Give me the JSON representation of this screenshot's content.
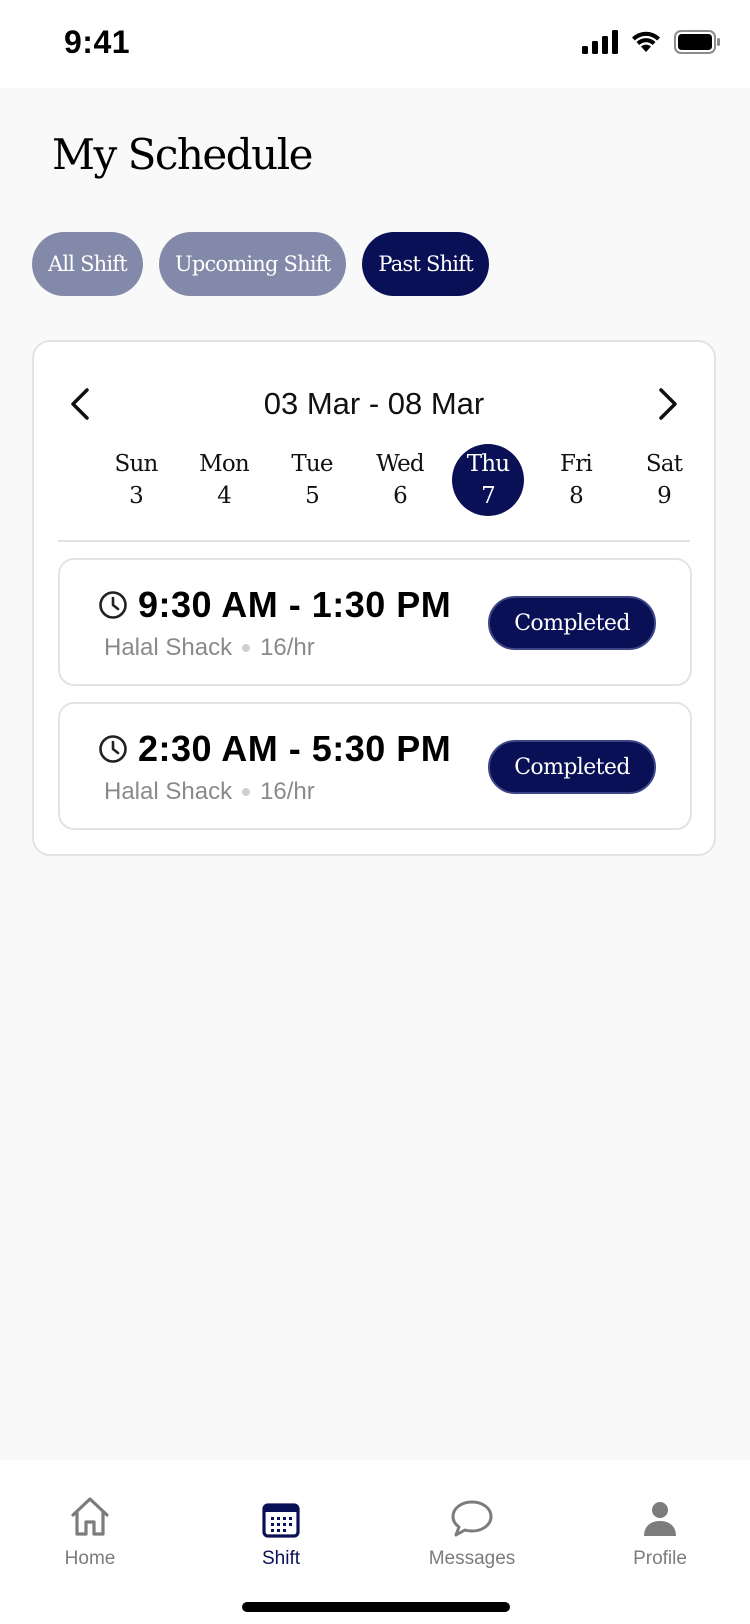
{
  "status_bar": {
    "time": "9:41"
  },
  "header": {
    "title": "My Schedule"
  },
  "filters": [
    {
      "label": "All Shift",
      "active": false
    },
    {
      "label": "Upcoming Shift",
      "active": false
    },
    {
      "label": "Past Shift",
      "active": true
    }
  ],
  "calendar": {
    "range_label": "03 Mar - 08 Mar",
    "days": [
      {
        "name": "Sun",
        "date": "3",
        "selected": false
      },
      {
        "name": "Mon",
        "date": "4",
        "selected": false
      },
      {
        "name": "Tue",
        "date": "5",
        "selected": false
      },
      {
        "name": "Wed",
        "date": "6",
        "selected": false
      },
      {
        "name": "Thu",
        "date": "7",
        "selected": true
      },
      {
        "name": "Fri",
        "date": "8",
        "selected": false
      },
      {
        "name": "Sat",
        "date": "9",
        "selected": false
      }
    ]
  },
  "shifts": [
    {
      "time": "9:30 AM - 1:30 PM",
      "place": "Halal Shack",
      "rate": "16/hr",
      "status": "Completed"
    },
    {
      "time": "2:30 AM - 5:30 PM",
      "place": "Halal Shack",
      "rate": "16/hr",
      "status": "Completed"
    }
  ],
  "tab_bar": {
    "tabs": [
      {
        "label": "Home",
        "icon": "home-icon",
        "active": false
      },
      {
        "label": "Shift",
        "icon": "calendar-icon",
        "active": true
      },
      {
        "label": "Messages",
        "icon": "chat-bubble-icon",
        "active": false
      },
      {
        "label": "Profile",
        "icon": "person-icon",
        "active": false
      }
    ]
  },
  "colors": {
    "primary": "#0a1056",
    "chip_inactive": "#8389a8",
    "muted_text": "#8a8a8a"
  }
}
